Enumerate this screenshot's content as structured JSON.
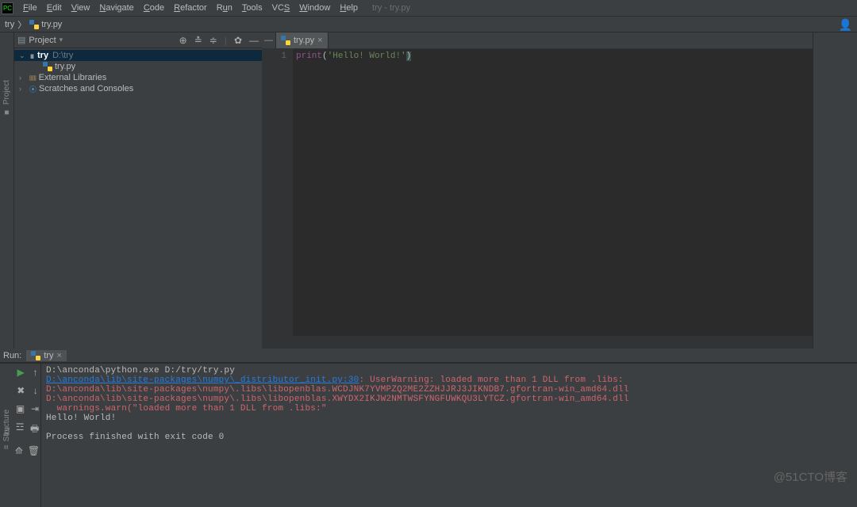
{
  "menu": {
    "items": [
      "File",
      "Edit",
      "View",
      "Navigate",
      "Code",
      "Refactor",
      "Run",
      "Tools",
      "VCS",
      "Window",
      "Help"
    ],
    "title_hint": "try - try.py"
  },
  "breadcrumb": {
    "root": "try",
    "file": "try.py"
  },
  "left_gutter": {
    "project": "Project",
    "structure": "Structure"
  },
  "project_panel": {
    "title": "Project",
    "tree": {
      "root": {
        "name": "try",
        "path": "D:\\try"
      },
      "file": "try.py",
      "ext_libs": "External Libraries",
      "scratches": "Scratches and Consoles"
    }
  },
  "editor": {
    "tab": "try.py",
    "line_no": "1",
    "code": {
      "fn": "print",
      "open": "(",
      "str": "'Hello! World!'",
      "close": ")"
    }
  },
  "run": {
    "label": "Run:",
    "tab": "try",
    "lines": {
      "cmd": "D:\\anconda\\python.exe D:/try/try.py",
      "link": "D:\\anconda\\lib\\site-packages\\numpy\\_distributor_init.py:30",
      "warn_tail": ": UserWarning: loaded more than 1 DLL from .libs:",
      "dll1": "D:\\anconda\\lib\\site-packages\\numpy\\.libs\\libopenblas.WCDJNK7YVMPZQ2ME2ZZHJJRJ3JIKNDB7.gfortran-win_amd64.dll",
      "dll2": "D:\\anconda\\lib\\site-packages\\numpy\\.libs\\libopenblas.XWYDX2IKJW2NMTWSFYNGFUWKQU3LYTCZ.gfortran-win_amd64.dll",
      "warn_call": "  warnings.warn(\"loaded more than 1 DLL from .libs:\"",
      "output": "Hello! World!",
      "exit": "Process finished with exit code 0"
    }
  },
  "watermark": "@51CTO博客"
}
